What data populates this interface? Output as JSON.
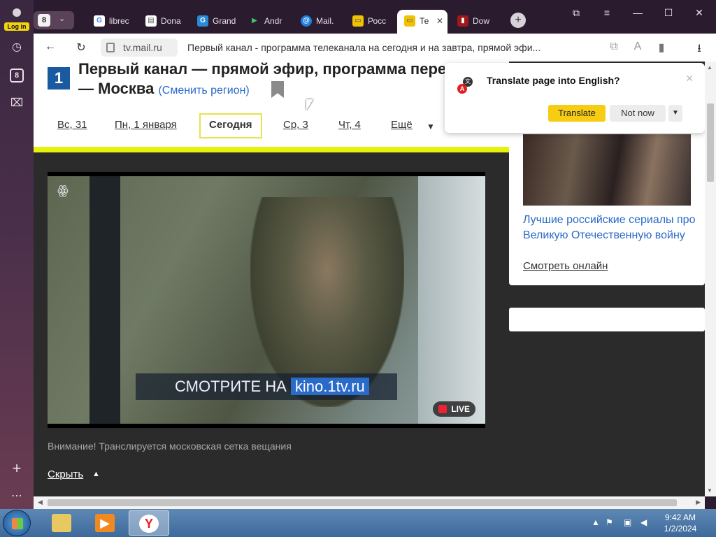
{
  "sidebar": {
    "login_label": "Log in",
    "tab_count": "8"
  },
  "tabbar": {
    "tab_count": "8",
    "tabs": [
      {
        "label": "librec",
        "icon": "google-icon"
      },
      {
        "label": "Dona",
        "icon": "document-icon"
      },
      {
        "label": "Grand",
        "icon": "grand-icon"
      },
      {
        "label": "Andr",
        "icon": "play-icon"
      },
      {
        "label": "Mail.",
        "icon": "mail-icon"
      },
      {
        "label": "Росс",
        "icon": "tv-icon"
      },
      {
        "label": "Те",
        "icon": "tv-icon",
        "active": true
      },
      {
        "label": "Dow",
        "icon": "download-site-icon"
      }
    ]
  },
  "address_bar": {
    "url": "tv.mail.ru",
    "page_title": "Первый канал - программа телеканала на сегодня и на завтра, прямой эфи..."
  },
  "page": {
    "heading_line1": "Первый канал — прямой эфир, программа перед",
    "heading_line2": "— Москва",
    "change_region": "(Сменить регион)",
    "logo_text": "1",
    "days": [
      "Вс, 31",
      "Пн, 1 января",
      "Сегодня",
      "Ср, 3",
      "Чт, 4",
      "Ещё"
    ],
    "video_overlay_prefix": "СМОТРИТЕ НА",
    "video_overlay_link": "kino.1tv.ru",
    "live_label": "LIVE",
    "notice": "Внимание! Транслируется московская сетка вещания",
    "hide_label": "Скрыть"
  },
  "right_card": {
    "title": "Лучшие российские сериалы про Великую Отечественную войну",
    "watch_label": "Смотреть онлайн"
  },
  "translate_popup": {
    "question": "Translate page into English?",
    "translate_button": "Translate",
    "not_now_button": "Not now"
  },
  "taskbar": {
    "time": "9:42 AM",
    "date": "1/2/2024"
  },
  "colors": {
    "accent_yellow": "#f7cd13",
    "link_blue": "#2a6ac8",
    "channel_blue": "#1a5aa0"
  }
}
